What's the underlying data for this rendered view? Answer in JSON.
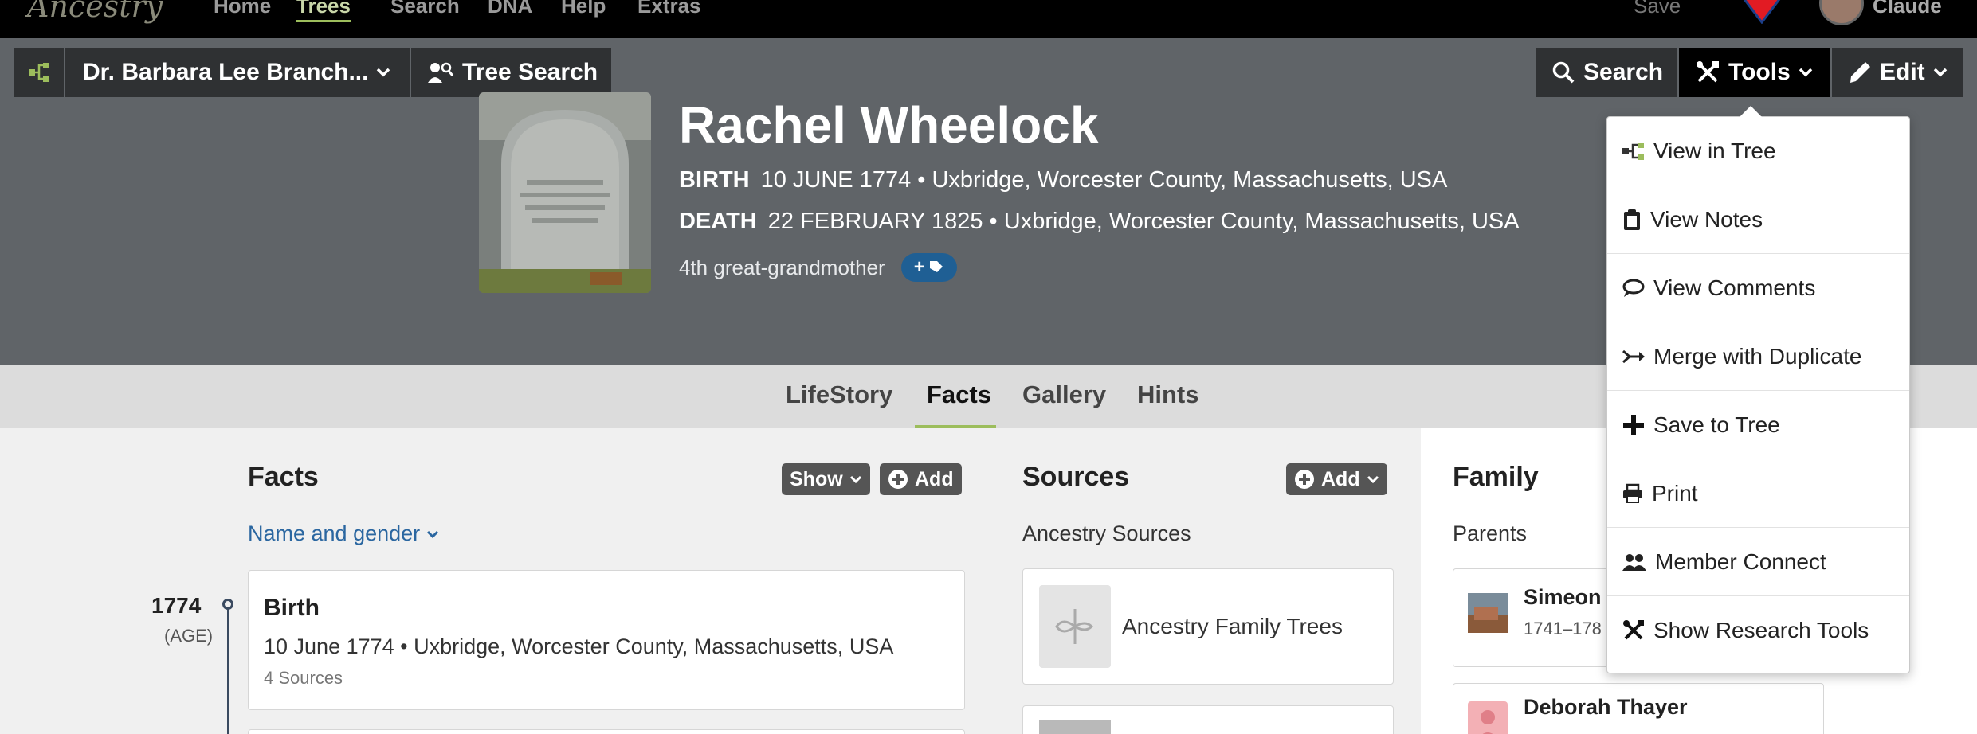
{
  "topnav": {
    "logo": "Ancestry",
    "items": [
      "Home",
      "Trees",
      "Search",
      "DNA",
      "Help",
      "Extras"
    ],
    "save_label": "Save",
    "user_name": "Claude"
  },
  "toolbar": {
    "tree_name": "Dr. Barbara Lee Branch...",
    "tree_search_label": "Tree Search",
    "search_label": "Search",
    "tools_label": "Tools",
    "edit_label": "Edit"
  },
  "person": {
    "name": "Rachel Wheelock",
    "birth_label": "BIRTH",
    "birth_value": "10 JUNE 1774 • Uxbridge, Worcester County, Massachusetts, USA",
    "death_label": "DEATH",
    "death_value": "22 FEBRUARY 1825 • Uxbridge, Worcester County, Massachusetts, USA",
    "relationship": "4th great-grandmother",
    "badge": "+"
  },
  "tabs": [
    "LifeStory",
    "Facts",
    "Gallery",
    "Hints"
  ],
  "active_tab": "Facts",
  "facts": {
    "title": "Facts",
    "show_label": "Show",
    "add_label": "Add",
    "name_gender_label": "Name and gender",
    "year": "1774",
    "age_label": "(AGE)",
    "event_title": "Birth",
    "event_detail": "10 June 1774 • Uxbridge, Worcester County, Massachusetts, USA",
    "event_sources": "4 Sources"
  },
  "sources": {
    "title": "Sources",
    "add_label": "Add",
    "subtitle": "Ancestry Sources",
    "items": [
      "Ancestry Family Trees"
    ]
  },
  "family": {
    "title": "Family",
    "parents_label": "Parents",
    "father_name": "Simeon",
    "father_dates": "1741–178",
    "mother_name": "Deborah Thayer"
  },
  "tools_menu": [
    {
      "icon": "tree-icon",
      "label": "View in Tree"
    },
    {
      "icon": "clipboard-icon",
      "label": "View Notes"
    },
    {
      "icon": "comment-icon",
      "label": "View Comments"
    },
    {
      "icon": "merge-icon",
      "label": "Merge with Duplicate"
    },
    {
      "icon": "plus-icon",
      "label": "Save to Tree"
    },
    {
      "icon": "print-icon",
      "label": "Print"
    },
    {
      "icon": "members-icon",
      "label": "Member Connect"
    },
    {
      "icon": "tools-icon",
      "label": "Show Research Tools"
    }
  ],
  "colors": {
    "header_gray": "#606468",
    "toolbar_dark": "#2f3133",
    "accent_green": "#9cbd5c",
    "badge_blue": "#1f5f94",
    "link_blue": "#2a66a0",
    "arrow_red": "#e21b23"
  }
}
